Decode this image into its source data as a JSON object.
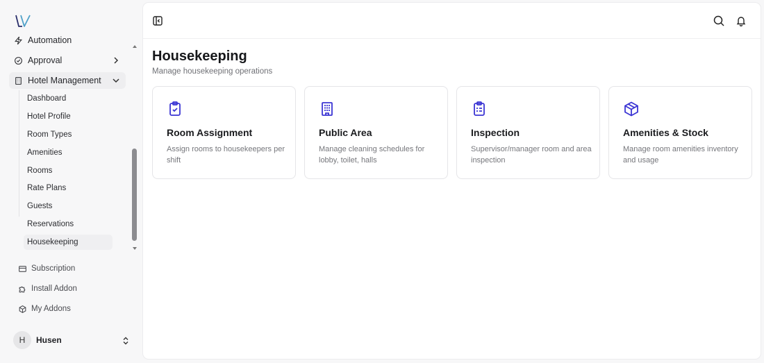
{
  "brand": {
    "logo_icon": "lv-logo-icon"
  },
  "sidebar": {
    "nav_items": [
      {
        "label": "Automation",
        "icon": "automation-icon"
      },
      {
        "label": "Approval",
        "icon": "check-circle-icon"
      },
      {
        "label": "Hotel Management",
        "icon": "building-icon"
      }
    ],
    "sub_items": [
      {
        "label": "Dashboard"
      },
      {
        "label": "Hotel Profile"
      },
      {
        "label": "Room Types"
      },
      {
        "label": "Amenities"
      },
      {
        "label": "Rooms"
      },
      {
        "label": "Rate Plans"
      },
      {
        "label": "Guests"
      },
      {
        "label": "Reservations"
      },
      {
        "label": "Housekeeping"
      }
    ],
    "bottom_items": [
      {
        "label": "Subscription",
        "icon": "credit-card-icon"
      },
      {
        "label": "Install Addon",
        "icon": "puzzle-icon"
      },
      {
        "label": "My Addons",
        "icon": "package-icon"
      }
    ],
    "user": {
      "initial": "H",
      "name": "Husen"
    }
  },
  "page": {
    "title": "Housekeeping",
    "subtitle": "Manage housekeeping operations"
  },
  "cards": [
    {
      "title": "Room Assignment",
      "description": "Assign rooms to housekeepers per shift",
      "icon": "clipboard-check-icon"
    },
    {
      "title": "Public Area",
      "description": "Manage cleaning schedules for lobby, toilet, halls",
      "icon": "building-icon"
    },
    {
      "title": "Inspection",
      "description": "Supervisor/manager room and area inspection",
      "icon": "clipboard-list-icon"
    },
    {
      "title": "Amenities & Stock",
      "description": "Manage room amenities inventory and usage",
      "icon": "package-icon"
    }
  ],
  "colors": {
    "accent": "#3b35d4",
    "text": "#1f2024",
    "muted": "#75767b"
  }
}
